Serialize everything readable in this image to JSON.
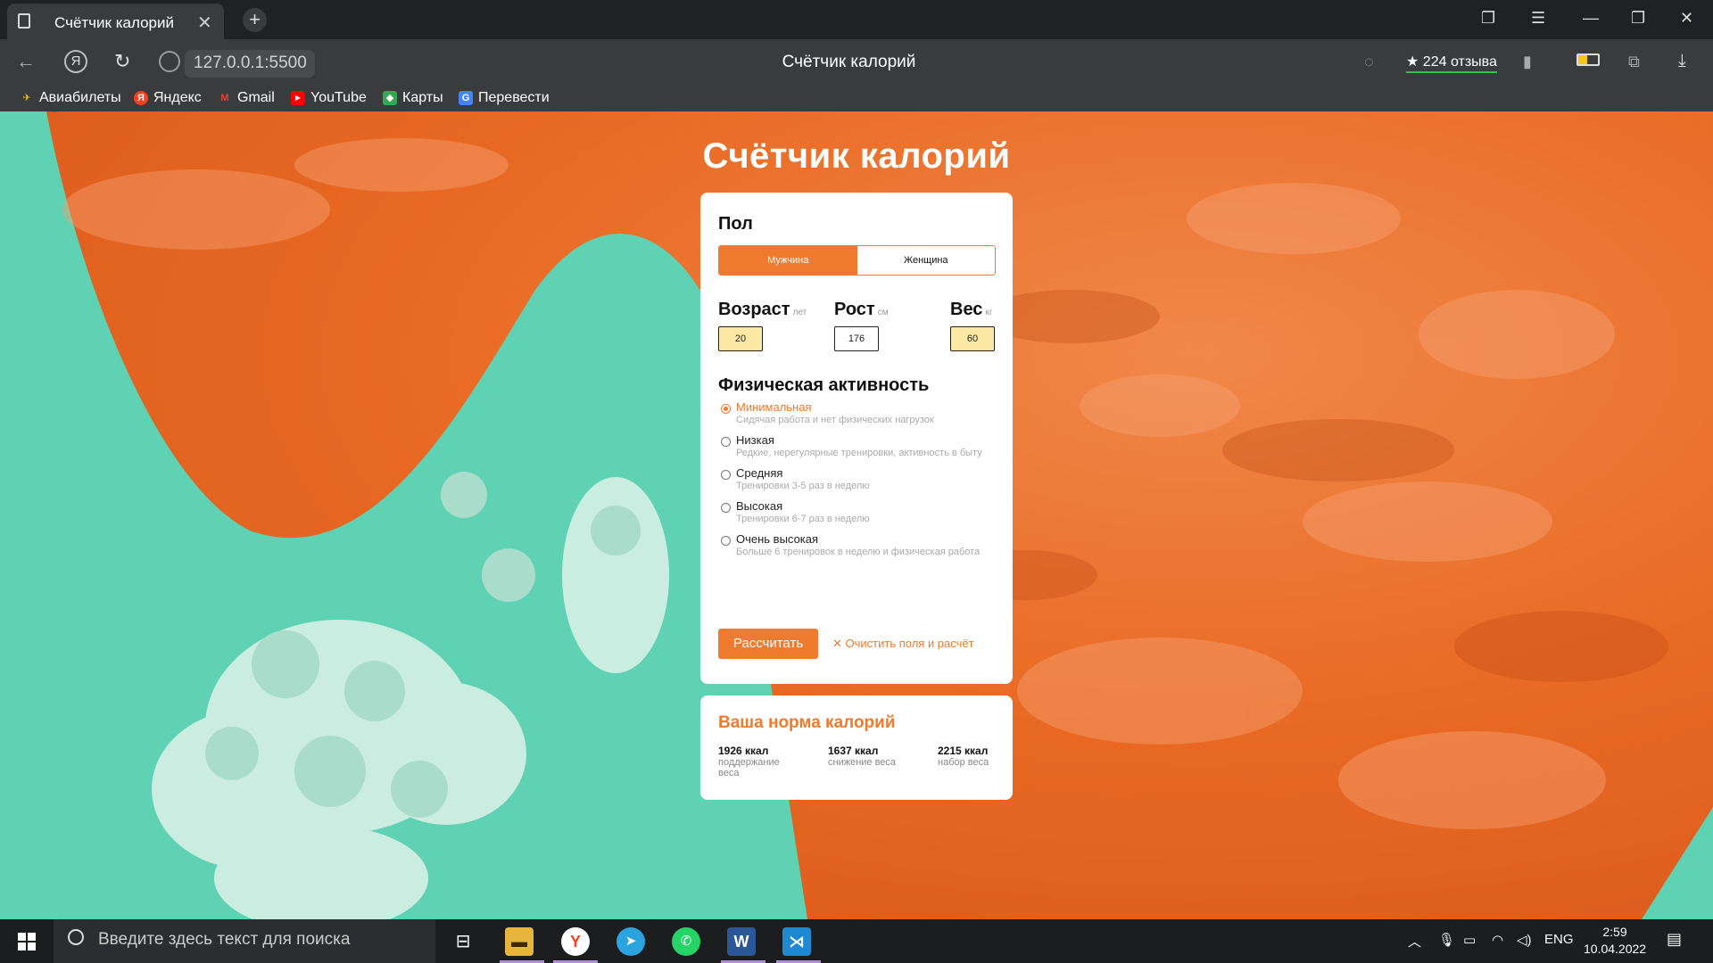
{
  "browser": {
    "tab_title": "Счётчик калорий",
    "url": "127.0.0.1:5500",
    "page_title": "Счётчик калорий",
    "reviews": "224 отзыва",
    "bookmarks": [
      {
        "label": "Авиабилеты",
        "icon": "plane-icon",
        "color": "#f5c518"
      },
      {
        "label": "Яндекс",
        "icon": "yandex-icon",
        "color": "#fc3f1d"
      },
      {
        "label": "Gmail",
        "icon": "gmail-icon",
        "color": "#ea4335"
      },
      {
        "label": "YouTube",
        "icon": "youtube-icon",
        "color": "#ff0000"
      },
      {
        "label": "Карты",
        "icon": "maps-icon",
        "color": "#34a853"
      },
      {
        "label": "Перевести",
        "icon": "translate-icon",
        "color": "#4285f4"
      }
    ]
  },
  "app": {
    "title": "Счётчик калорий",
    "accent": "#f07a2d",
    "gender": {
      "label": "Пол",
      "options": [
        "Мужчина",
        "Женщина"
      ],
      "selected": "Мужчина"
    },
    "params": {
      "age": {
        "label": "Возраст",
        "unit": "лет",
        "value": "20"
      },
      "height": {
        "label": "Рост",
        "unit": "см",
        "value": "176"
      },
      "weight": {
        "label": "Вес",
        "unit": "кг",
        "value": "60"
      }
    },
    "activity": {
      "label": "Физическая активность",
      "selected": 0,
      "options": [
        {
          "name": "Минимальная",
          "desc": "Сидячая работа и нет физических нагрузок"
        },
        {
          "name": "Низкая",
          "desc": "Редкие, нерегулярные тренировки, активность в быту"
        },
        {
          "name": "Средняя",
          "desc": "Тренировки 3-5 раз в неделю"
        },
        {
          "name": "Высокая",
          "desc": "Тренировки 6-7 раз в неделю"
        },
        {
          "name": "Очень высокая",
          "desc": "Больше 6 тренировок в неделю и физическая работа"
        }
      ]
    },
    "buttons": {
      "calculate": "Рассчитать",
      "clear": "Очистить поля и расчёт"
    },
    "result": {
      "title": "Ваша норма калорий",
      "items": [
        {
          "value": "1926 ккал",
          "desc": "поддержание веса"
        },
        {
          "value": "1637 ккал",
          "desc": "снижение веса"
        },
        {
          "value": "2215 ккал",
          "desc": "набор веса"
        }
      ]
    }
  },
  "taskbar": {
    "search_placeholder": "Введите здесь текст для поиска",
    "lang": "ENG",
    "time": "2:59",
    "date": "10.04.2022"
  }
}
